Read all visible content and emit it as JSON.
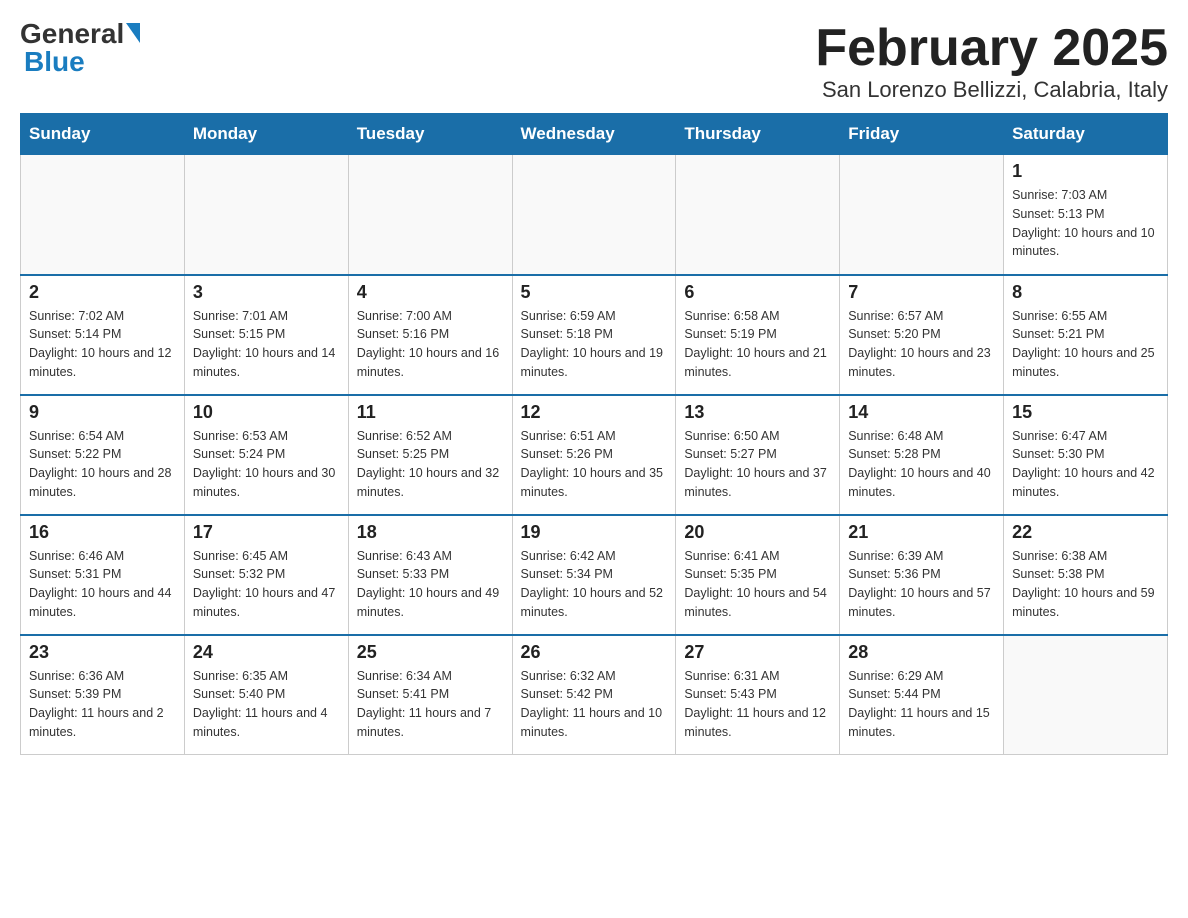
{
  "logo": {
    "general": "General",
    "blue": "Blue"
  },
  "title": "February 2025",
  "subtitle": "San Lorenzo Bellizzi, Calabria, Italy",
  "weekdays": [
    "Sunday",
    "Monday",
    "Tuesday",
    "Wednesday",
    "Thursday",
    "Friday",
    "Saturday"
  ],
  "weeks": [
    [
      {
        "day": "",
        "info": ""
      },
      {
        "day": "",
        "info": ""
      },
      {
        "day": "",
        "info": ""
      },
      {
        "day": "",
        "info": ""
      },
      {
        "day": "",
        "info": ""
      },
      {
        "day": "",
        "info": ""
      },
      {
        "day": "1",
        "info": "Sunrise: 7:03 AM\nSunset: 5:13 PM\nDaylight: 10 hours and 10 minutes."
      }
    ],
    [
      {
        "day": "2",
        "info": "Sunrise: 7:02 AM\nSunset: 5:14 PM\nDaylight: 10 hours and 12 minutes."
      },
      {
        "day": "3",
        "info": "Sunrise: 7:01 AM\nSunset: 5:15 PM\nDaylight: 10 hours and 14 minutes."
      },
      {
        "day": "4",
        "info": "Sunrise: 7:00 AM\nSunset: 5:16 PM\nDaylight: 10 hours and 16 minutes."
      },
      {
        "day": "5",
        "info": "Sunrise: 6:59 AM\nSunset: 5:18 PM\nDaylight: 10 hours and 19 minutes."
      },
      {
        "day": "6",
        "info": "Sunrise: 6:58 AM\nSunset: 5:19 PM\nDaylight: 10 hours and 21 minutes."
      },
      {
        "day": "7",
        "info": "Sunrise: 6:57 AM\nSunset: 5:20 PM\nDaylight: 10 hours and 23 minutes."
      },
      {
        "day": "8",
        "info": "Sunrise: 6:55 AM\nSunset: 5:21 PM\nDaylight: 10 hours and 25 minutes."
      }
    ],
    [
      {
        "day": "9",
        "info": "Sunrise: 6:54 AM\nSunset: 5:22 PM\nDaylight: 10 hours and 28 minutes."
      },
      {
        "day": "10",
        "info": "Sunrise: 6:53 AM\nSunset: 5:24 PM\nDaylight: 10 hours and 30 minutes."
      },
      {
        "day": "11",
        "info": "Sunrise: 6:52 AM\nSunset: 5:25 PM\nDaylight: 10 hours and 32 minutes."
      },
      {
        "day": "12",
        "info": "Sunrise: 6:51 AM\nSunset: 5:26 PM\nDaylight: 10 hours and 35 minutes."
      },
      {
        "day": "13",
        "info": "Sunrise: 6:50 AM\nSunset: 5:27 PM\nDaylight: 10 hours and 37 minutes."
      },
      {
        "day": "14",
        "info": "Sunrise: 6:48 AM\nSunset: 5:28 PM\nDaylight: 10 hours and 40 minutes."
      },
      {
        "day": "15",
        "info": "Sunrise: 6:47 AM\nSunset: 5:30 PM\nDaylight: 10 hours and 42 minutes."
      }
    ],
    [
      {
        "day": "16",
        "info": "Sunrise: 6:46 AM\nSunset: 5:31 PM\nDaylight: 10 hours and 44 minutes."
      },
      {
        "day": "17",
        "info": "Sunrise: 6:45 AM\nSunset: 5:32 PM\nDaylight: 10 hours and 47 minutes."
      },
      {
        "day": "18",
        "info": "Sunrise: 6:43 AM\nSunset: 5:33 PM\nDaylight: 10 hours and 49 minutes."
      },
      {
        "day": "19",
        "info": "Sunrise: 6:42 AM\nSunset: 5:34 PM\nDaylight: 10 hours and 52 minutes."
      },
      {
        "day": "20",
        "info": "Sunrise: 6:41 AM\nSunset: 5:35 PM\nDaylight: 10 hours and 54 minutes."
      },
      {
        "day": "21",
        "info": "Sunrise: 6:39 AM\nSunset: 5:36 PM\nDaylight: 10 hours and 57 minutes."
      },
      {
        "day": "22",
        "info": "Sunrise: 6:38 AM\nSunset: 5:38 PM\nDaylight: 10 hours and 59 minutes."
      }
    ],
    [
      {
        "day": "23",
        "info": "Sunrise: 6:36 AM\nSunset: 5:39 PM\nDaylight: 11 hours and 2 minutes."
      },
      {
        "day": "24",
        "info": "Sunrise: 6:35 AM\nSunset: 5:40 PM\nDaylight: 11 hours and 4 minutes."
      },
      {
        "day": "25",
        "info": "Sunrise: 6:34 AM\nSunset: 5:41 PM\nDaylight: 11 hours and 7 minutes."
      },
      {
        "day": "26",
        "info": "Sunrise: 6:32 AM\nSunset: 5:42 PM\nDaylight: 11 hours and 10 minutes."
      },
      {
        "day": "27",
        "info": "Sunrise: 6:31 AM\nSunset: 5:43 PM\nDaylight: 11 hours and 12 minutes."
      },
      {
        "day": "28",
        "info": "Sunrise: 6:29 AM\nSunset: 5:44 PM\nDaylight: 11 hours and 15 minutes."
      },
      {
        "day": "",
        "info": ""
      }
    ]
  ]
}
